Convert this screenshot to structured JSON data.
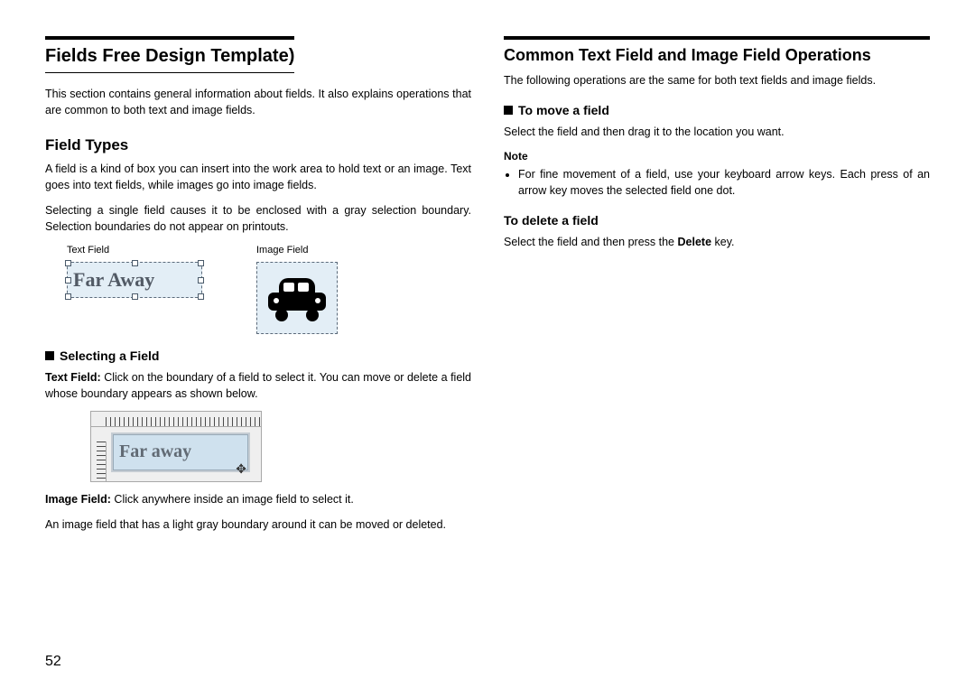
{
  "left": {
    "title": "Fields Free Design Template)",
    "intro": "This section contains general information about fields. It also explains operations that are common to both text and image fields.",
    "sub1": "Field Types",
    "p1": "A field is a kind of box you can insert into the work area to hold text or an image. Text goes into text fields, while images go into image fields.",
    "p2": "Selecting a single field causes it to be enclosed with a gray selection boundary. Selection boundaries do not appear on printouts.",
    "fig_text_label": "Text Field",
    "fig_image_label": "Image Field",
    "textfield_sample": "Far Away",
    "sub2": "Selecting a Field",
    "p3a": "Text Field:",
    "p3b": " Click on the boundary of a field to select it. You can move or delete a field whose boundary appears as shown below.",
    "textfield_sample2": "Far away",
    "p4a": "Image Field:",
    "p4b": " Click anywhere inside an image field to select it.",
    "p5": "An image field that has a light gray boundary around it can be moved or deleted."
  },
  "right": {
    "title": "Common Text Field and Image Field Operations",
    "intro": "The following operations are the same for both text fields and image fields.",
    "sub1": "To move a field",
    "p1": "Select the field and then drag it to the location you want.",
    "note_label": "Note",
    "note_item": "For fine movement of a field, use your keyboard arrow keys. Each press of an arrow key moves the selected field one dot.",
    "sub2": "To delete a field",
    "p2a": "Select the field and then press the ",
    "p2b": "Delete",
    "p2c": " key."
  },
  "page_number": "52"
}
